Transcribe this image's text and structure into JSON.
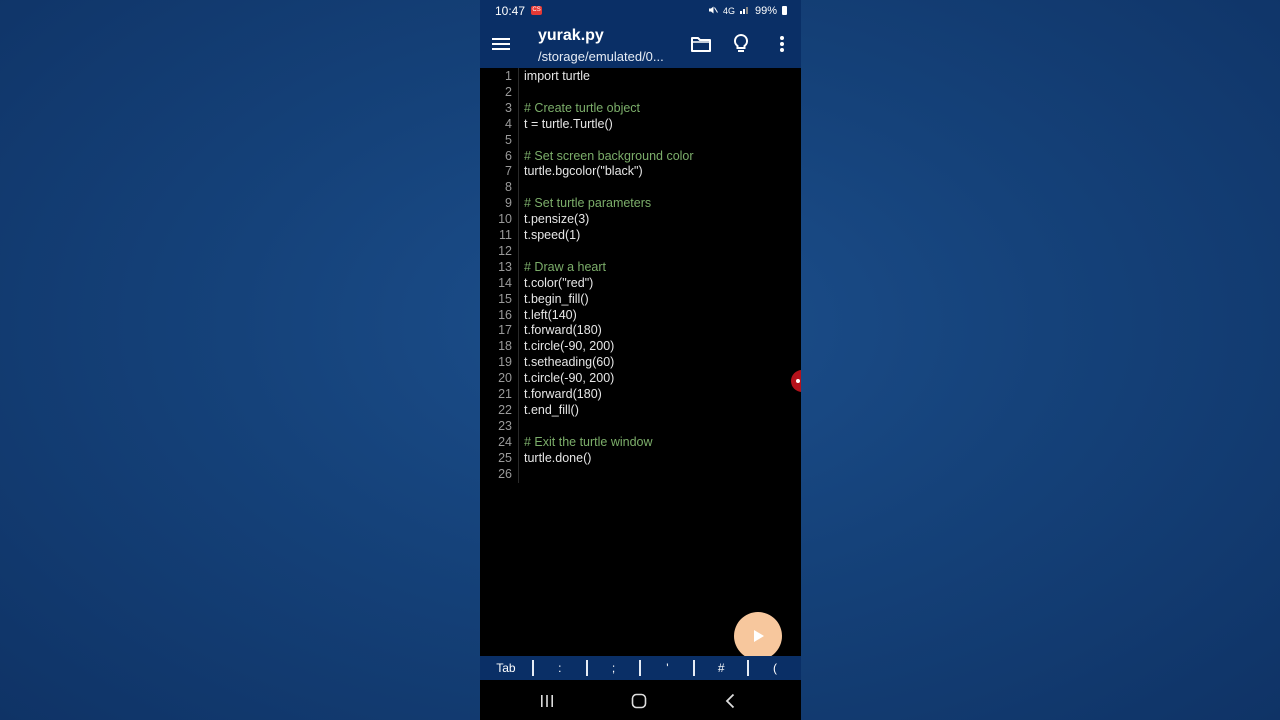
{
  "status_bar": {
    "time": "10:47",
    "rec_badge": "CS",
    "network": "4G",
    "battery": "99%"
  },
  "app_bar": {
    "title": "yurak.py",
    "subtitle": "/storage/emulated/0..."
  },
  "editor": {
    "lines": [
      {
        "n": "1",
        "text": "import turtle",
        "type": "code"
      },
      {
        "n": "2",
        "text": "",
        "type": "code"
      },
      {
        "n": "3",
        "text": "# Create turtle object",
        "type": "comment"
      },
      {
        "n": "4",
        "text": "t = turtle.Turtle()",
        "type": "code"
      },
      {
        "n": "5",
        "text": "",
        "type": "code"
      },
      {
        "n": "6",
        "text": "# Set screen background color",
        "type": "comment"
      },
      {
        "n": "7",
        "text": "turtle.bgcolor(\"black\")",
        "type": "code"
      },
      {
        "n": "8",
        "text": "",
        "type": "code"
      },
      {
        "n": "9",
        "text": "# Set turtle parameters",
        "type": "comment"
      },
      {
        "n": "10",
        "text": "t.pensize(3)",
        "type": "code"
      },
      {
        "n": "11",
        "text": "t.speed(1)",
        "type": "code"
      },
      {
        "n": "12",
        "text": "",
        "type": "code"
      },
      {
        "n": "13",
        "text": "# Draw a heart",
        "type": "comment"
      },
      {
        "n": "14",
        "text": "t.color(\"red\")",
        "type": "code"
      },
      {
        "n": "15",
        "text": "t.begin_fill()",
        "type": "code"
      },
      {
        "n": "16",
        "text": "t.left(140)",
        "type": "code"
      },
      {
        "n": "17",
        "text": "t.forward(180)",
        "type": "code"
      },
      {
        "n": "18",
        "text": "t.circle(-90, 200)",
        "type": "code"
      },
      {
        "n": "19",
        "text": "t.setheading(60)",
        "type": "code"
      },
      {
        "n": "20",
        "text": "t.circle(-90, 200)",
        "type": "code"
      },
      {
        "n": "21",
        "text": "t.forward(180)",
        "type": "code"
      },
      {
        "n": "22",
        "text": "t.end_fill()",
        "type": "code"
      },
      {
        "n": "23",
        "text": "",
        "type": "code"
      },
      {
        "n": "24",
        "text": "# Exit the turtle window",
        "type": "comment"
      },
      {
        "n": "25",
        "text": "turtle.done()",
        "type": "code"
      },
      {
        "n": "26",
        "text": "",
        "type": "code"
      }
    ]
  },
  "symbol_bar": {
    "keys": [
      "Tab",
      ":",
      ";",
      "'",
      "#",
      "("
    ]
  },
  "colors": {
    "app_bar": "#0a2f66",
    "comment": "#7cae6a",
    "fab": "#f7c79d",
    "marker": "#b5121b"
  },
  "icons": {
    "menu": "menu-icon",
    "folder": "folder-icon",
    "bulb": "lightbulb-icon",
    "more": "more-vertical-icon",
    "run": "play-icon",
    "recents": "recents-icon",
    "home": "home-icon",
    "back": "back-icon"
  }
}
